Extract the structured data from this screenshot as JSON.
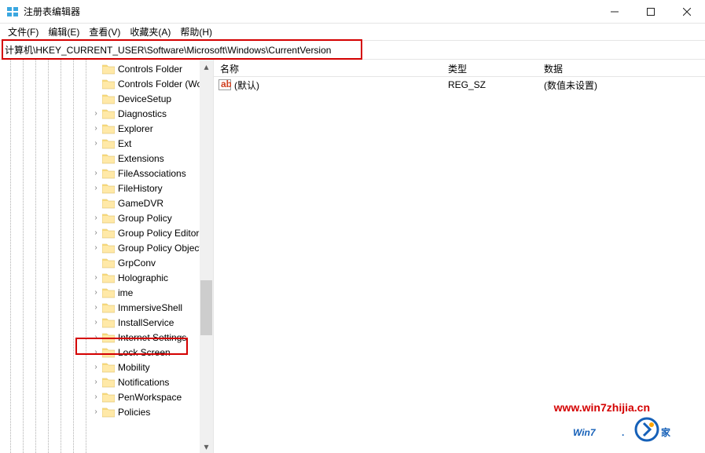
{
  "window": {
    "title": "注册表编辑器"
  },
  "menu": {
    "file": "文件(F)",
    "edit": "编辑(E)",
    "view": "查看(V)",
    "favorites": "收藏夹(A)",
    "help": "帮助(H)"
  },
  "address": {
    "path": "计算机\\HKEY_CURRENT_USER\\Software\\Microsoft\\Windows\\CurrentVersion"
  },
  "tree": {
    "items": [
      {
        "label": "Controls Folder",
        "expander": ""
      },
      {
        "label": "Controls Folder (Wo",
        "expander": ""
      },
      {
        "label": "DeviceSetup",
        "expander": ""
      },
      {
        "label": "Diagnostics",
        "expander": ">"
      },
      {
        "label": "Explorer",
        "expander": ">"
      },
      {
        "label": "Ext",
        "expander": ">"
      },
      {
        "label": "Extensions",
        "expander": ""
      },
      {
        "label": "FileAssociations",
        "expander": ">"
      },
      {
        "label": "FileHistory",
        "expander": ">"
      },
      {
        "label": "GameDVR",
        "expander": ""
      },
      {
        "label": "Group Policy",
        "expander": ">"
      },
      {
        "label": "Group Policy Editor",
        "expander": ">"
      },
      {
        "label": "Group Policy Objects",
        "expander": ">"
      },
      {
        "label": "GrpConv",
        "expander": ""
      },
      {
        "label": "Holographic",
        "expander": ">"
      },
      {
        "label": "ime",
        "expander": ">"
      },
      {
        "label": "ImmersiveShell",
        "expander": ">"
      },
      {
        "label": "InstallService",
        "expander": ">"
      },
      {
        "label": "Internet Settings",
        "expander": ">"
      },
      {
        "label": "Lock Screen",
        "expander": ">"
      },
      {
        "label": "Mobility",
        "expander": ">"
      },
      {
        "label": "Notifications",
        "expander": ">"
      },
      {
        "label": "PenWorkspace",
        "expander": ">"
      },
      {
        "label": "Policies",
        "expander": ">"
      }
    ]
  },
  "columns": {
    "name": "名称",
    "type": "类型",
    "data": "数据"
  },
  "values": [
    {
      "name": "(默认)",
      "type": "REG_SZ",
      "data": "(数值未设置)"
    }
  ],
  "watermark": {
    "url": "www.win7zhijia.cn",
    "logo": "Win7之家"
  }
}
